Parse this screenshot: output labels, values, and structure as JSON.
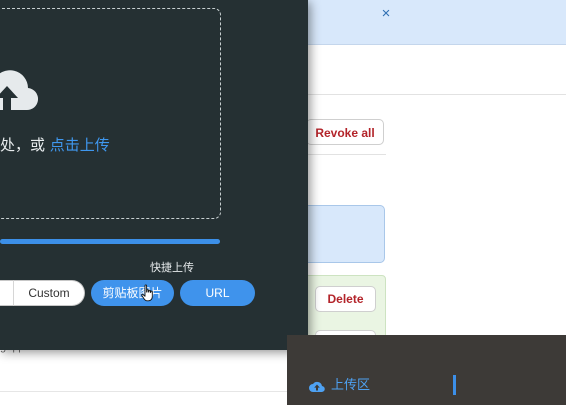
{
  "background_app": {
    "close_symbol": "×",
    "revoke_all_label": "Revoke all",
    "delete_label": "Delete",
    "cut_text": "g. | |"
  },
  "upload_panel": {
    "cloud_icon": "cloud-upload-icon",
    "drop_hint_prefix": "处，或 ",
    "drop_hint_link": "点击上传",
    "progress": 1.0,
    "quick_upload_label": "快捷上传",
    "custom_label": "Custom",
    "clipboard_label": "剪贴板图片",
    "url_label": "URL",
    "accent_color": "#3f93ec"
  },
  "dock": {
    "upload_area_label": "上传区",
    "upload_area_icon": "cloud-upload-icon"
  }
}
